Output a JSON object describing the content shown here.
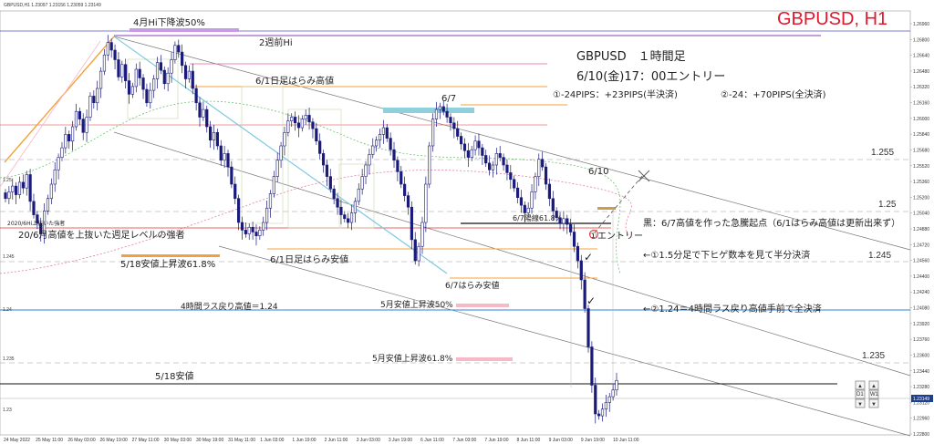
{
  "header": {
    "info": "GBPUSD,H1  1.23097 1.23156 1.23059 1.23149",
    "title": "GBPUSD, H1",
    "title_color": "#e0182d"
  },
  "chart_data": {
    "type": "candlestick",
    "symbol": "GBPUSD",
    "timeframe": "H1",
    "y_range": [
      1.2278,
      1.2696
    ],
    "y_ticks": [
      "1.26960",
      "1.26800",
      "1.26640",
      "1.26480",
      "1.26320",
      "1.26160",
      "1.26000",
      "1.25840",
      "1.25680",
      "1.25520",
      "1.25360",
      "1.25200",
      "1.25040",
      "1.24880",
      "1.24720",
      "1.24560",
      "1.24400",
      "1.24240",
      "1.24080",
      "1.23920",
      "1.23760",
      "1.23600",
      "1.23440",
      "1.23280",
      "1.23120",
      "1.22960",
      "1.22800"
    ],
    "price_tag": "1.23149",
    "x_ticks": [
      "24 May 2022",
      "25 May 11:00",
      "26 May 03:00",
      "26 May 19:00",
      "27 May 11:00",
      "30 May 03:00",
      "30 May 19:00",
      "31 May 11:00",
      "1 Jun 03:00",
      "1 Jun 19:00",
      "2 Jun 11:00",
      "3 Jun 03:00",
      "3 Jun 19:00",
      "6 Jun 11:00",
      "7 Jun 03:00",
      "7 Jun 19:00",
      "8 Jun 11:00",
      "9 Jun 03:00",
      "9 Jun 19:00",
      "10 Jun 11:00"
    ],
    "candles_close": [
      1.2505,
      1.2512,
      1.2518,
      1.2509,
      1.2522,
      1.2516,
      1.253,
      1.2502,
      1.2488,
      1.2479,
      1.2468,
      1.2492,
      1.2505,
      1.252,
      1.2535,
      1.2548,
      1.2558,
      1.2572,
      1.2565,
      1.258,
      1.2596,
      1.2588,
      1.2574,
      1.259,
      1.2612,
      1.2605,
      1.262,
      1.2638,
      1.2655,
      1.2668,
      1.266,
      1.265,
      1.2632,
      1.2645,
      1.2628,
      1.2614,
      1.2622,
      1.264,
      1.2631,
      1.2619,
      1.2605,
      1.2618,
      1.263,
      1.2647,
      1.2639,
      1.2625,
      1.2636,
      1.265,
      1.2665,
      1.2658,
      1.2644,
      1.263,
      1.2638,
      1.262,
      1.2605,
      1.259,
      1.2598,
      1.258,
      1.2566,
      1.2574,
      1.256,
      1.2545,
      1.2552,
      1.2538,
      1.252,
      1.2505,
      1.248,
      1.2472,
      1.2468,
      1.2475,
      1.247,
      1.2466,
      1.2472,
      1.248,
      1.2495,
      1.251,
      1.2528,
      1.2545,
      1.256,
      1.2574,
      1.2586,
      1.259,
      1.2584,
      1.2579,
      1.2588,
      1.2592,
      1.2585,
      1.2578,
      1.2565,
      1.2552,
      1.254,
      1.2528,
      1.2515,
      1.2505,
      1.2496,
      1.2488,
      1.2484,
      1.248,
      1.249,
      1.2502,
      1.2515,
      1.2528,
      1.254,
      1.2551,
      1.256,
      1.2566,
      1.2572,
      1.2579,
      1.2568,
      1.2556,
      1.2545,
      1.2533,
      1.252,
      1.2508,
      1.2496,
      1.2462,
      1.244,
      1.2455,
      1.248,
      1.252,
      1.256,
      1.2588,
      1.2598,
      1.2601,
      1.2596,
      1.259,
      1.2584,
      1.2578,
      1.257,
      1.2562,
      1.2555,
      1.2548,
      1.2556,
      1.2565,
      1.2558,
      1.255,
      1.2542,
      1.2535,
      1.254,
      1.2552,
      1.2548,
      1.254,
      1.2532,
      1.2525,
      1.2516,
      1.2506,
      1.2498,
      1.249,
      1.2495,
      1.2512,
      1.2528,
      1.2546,
      1.2538,
      1.252,
      1.2505,
      1.2492,
      1.2485,
      1.2479,
      1.2484,
      1.2478,
      1.247,
      1.2455,
      1.244,
      1.242,
      1.239,
      1.235,
      1.231,
      1.228,
      1.2278,
      1.2285,
      1.2292,
      1.2298,
      1.2305,
      1.2315
    ]
  },
  "levels": [
    {
      "label": "1.255",
      "color": "#888888"
    },
    {
      "label": "1.25",
      "color": "#888888"
    },
    {
      "label": "1.245",
      "color": "#888888"
    },
    {
      "label": "1.235",
      "color": "#888888"
    }
  ],
  "annotations": {
    "a1": "4月Hi下降波50%",
    "a2": "2週前Hi",
    "a3": "6/1日足はらみ高値",
    "a4": "6/7",
    "a5": "6/10",
    "a6": "6/7陽線61.8%",
    "a7": "2020/6Hi上抜いた強者",
    "a8": "20/6月高値を上抜いた週足レベルの強者",
    "a9": "5/18安値上昇波61.8%",
    "a10": "6/1日足はらみ安値",
    "a11": "6/7はらみ安値",
    "a12": "5月安値上昇波50%",
    "a13": "4時間ラス戻り高値＝1.24",
    "a14": "5月安値上昇波61.8%",
    "a15": "5/18安値",
    "a16": "黒：6/7高値を作った急騰起点（6/1はらみ高値は更新出来ず）",
    "a17": "①エントリー",
    "a18": "←①1.5分足で下ヒゲ数本を見て半分決済",
    "a19": "←②1.24＝4時間ラス戻り高値手前で全決済",
    "t1": "GBPUSD　１時間足",
    "t2": "6/10(金)17：00エントリー",
    "t3a": "①-24PIPS：+23PIPS(半決済)",
    "t3b": "②-24：+70PIPS(全決済)"
  },
  "controls": {
    "up": "▲",
    "down": "▼",
    "d1": "D1",
    "w1": "W1",
    "left": "◀",
    "right": "▶"
  },
  "colors": {
    "bull": "#1a1a7a",
    "bear": "#1a1a7a",
    "purple": "#8a3fbf",
    "orange": "#f4a23a",
    "pink": "#e060a0",
    "red": "#e03030",
    "blue": "#2a86d8",
    "lightblue": "#7ec8e0"
  }
}
